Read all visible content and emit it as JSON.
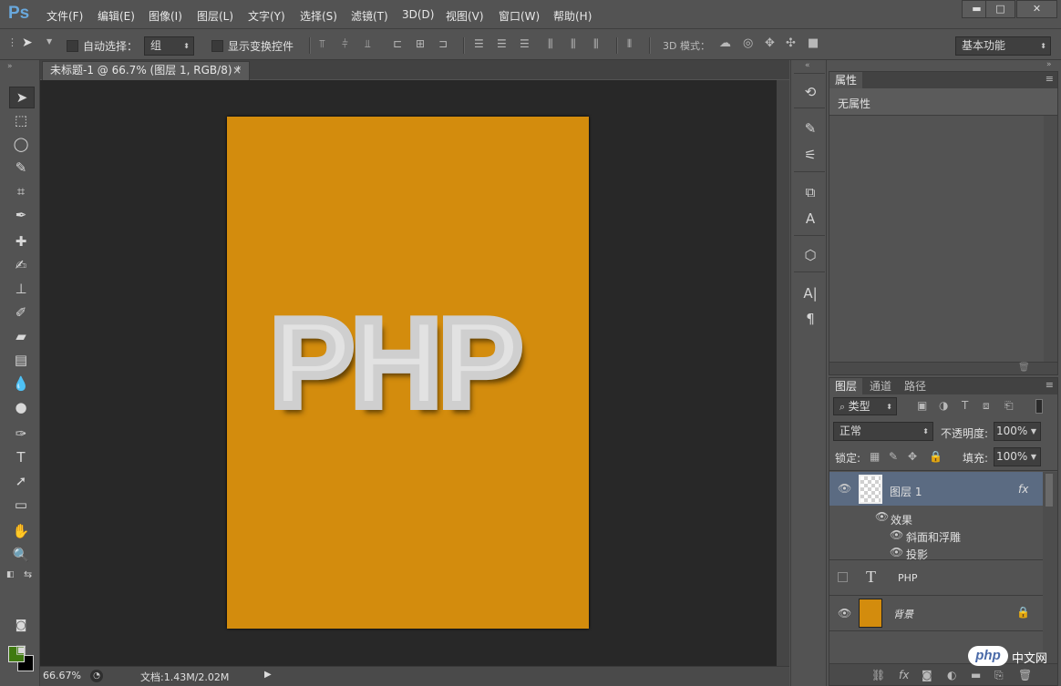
{
  "app": {
    "logo": "Ps"
  },
  "menu": [
    "文件(F)",
    "编辑(E)",
    "图像(I)",
    "图层(L)",
    "文字(Y)",
    "选择(S)",
    "滤镜(T)",
    "3D(D)",
    "视图(V)",
    "窗口(W)",
    "帮助(H)"
  ],
  "window_controls": {
    "minimize": "▬",
    "maximize": "□",
    "close": "✕"
  },
  "options": {
    "auto_select_label": "自动选择：",
    "auto_select_value": "组",
    "show_transform_label": "显示变换控件",
    "mode_3d_label": "3D 模式：",
    "workspace": "基本功能"
  },
  "document": {
    "tab_title": "未标题-1 @ 66.7% (图层 1, RGB/8) *",
    "close": "×",
    "canvas_color": "#d38c0d",
    "art_text": "PHP"
  },
  "status": {
    "zoom": "66.67%",
    "doc_info": "文档:1.43M/2.02M"
  },
  "properties": {
    "tab": "属性",
    "empty_text": "无属性"
  },
  "layers": {
    "tabs": [
      "图层",
      "通道",
      "路径"
    ],
    "filter_kind": "类型",
    "blend_mode": "正常",
    "opacity_label": "不透明度:",
    "opacity_value": "100%",
    "lock_label": "锁定:",
    "fill_label": "填充:",
    "fill_value": "100%",
    "items": [
      {
        "name": "图层 1",
        "fx": "fx",
        "effects_label": "效果",
        "effects": [
          "斜面和浮雕",
          "投影"
        ]
      },
      {
        "name": "PHP",
        "type_icon": "T"
      },
      {
        "name": "背景",
        "color": "#d38c0d"
      }
    ]
  },
  "watermark": {
    "logo": "php",
    "text": "中文网"
  }
}
